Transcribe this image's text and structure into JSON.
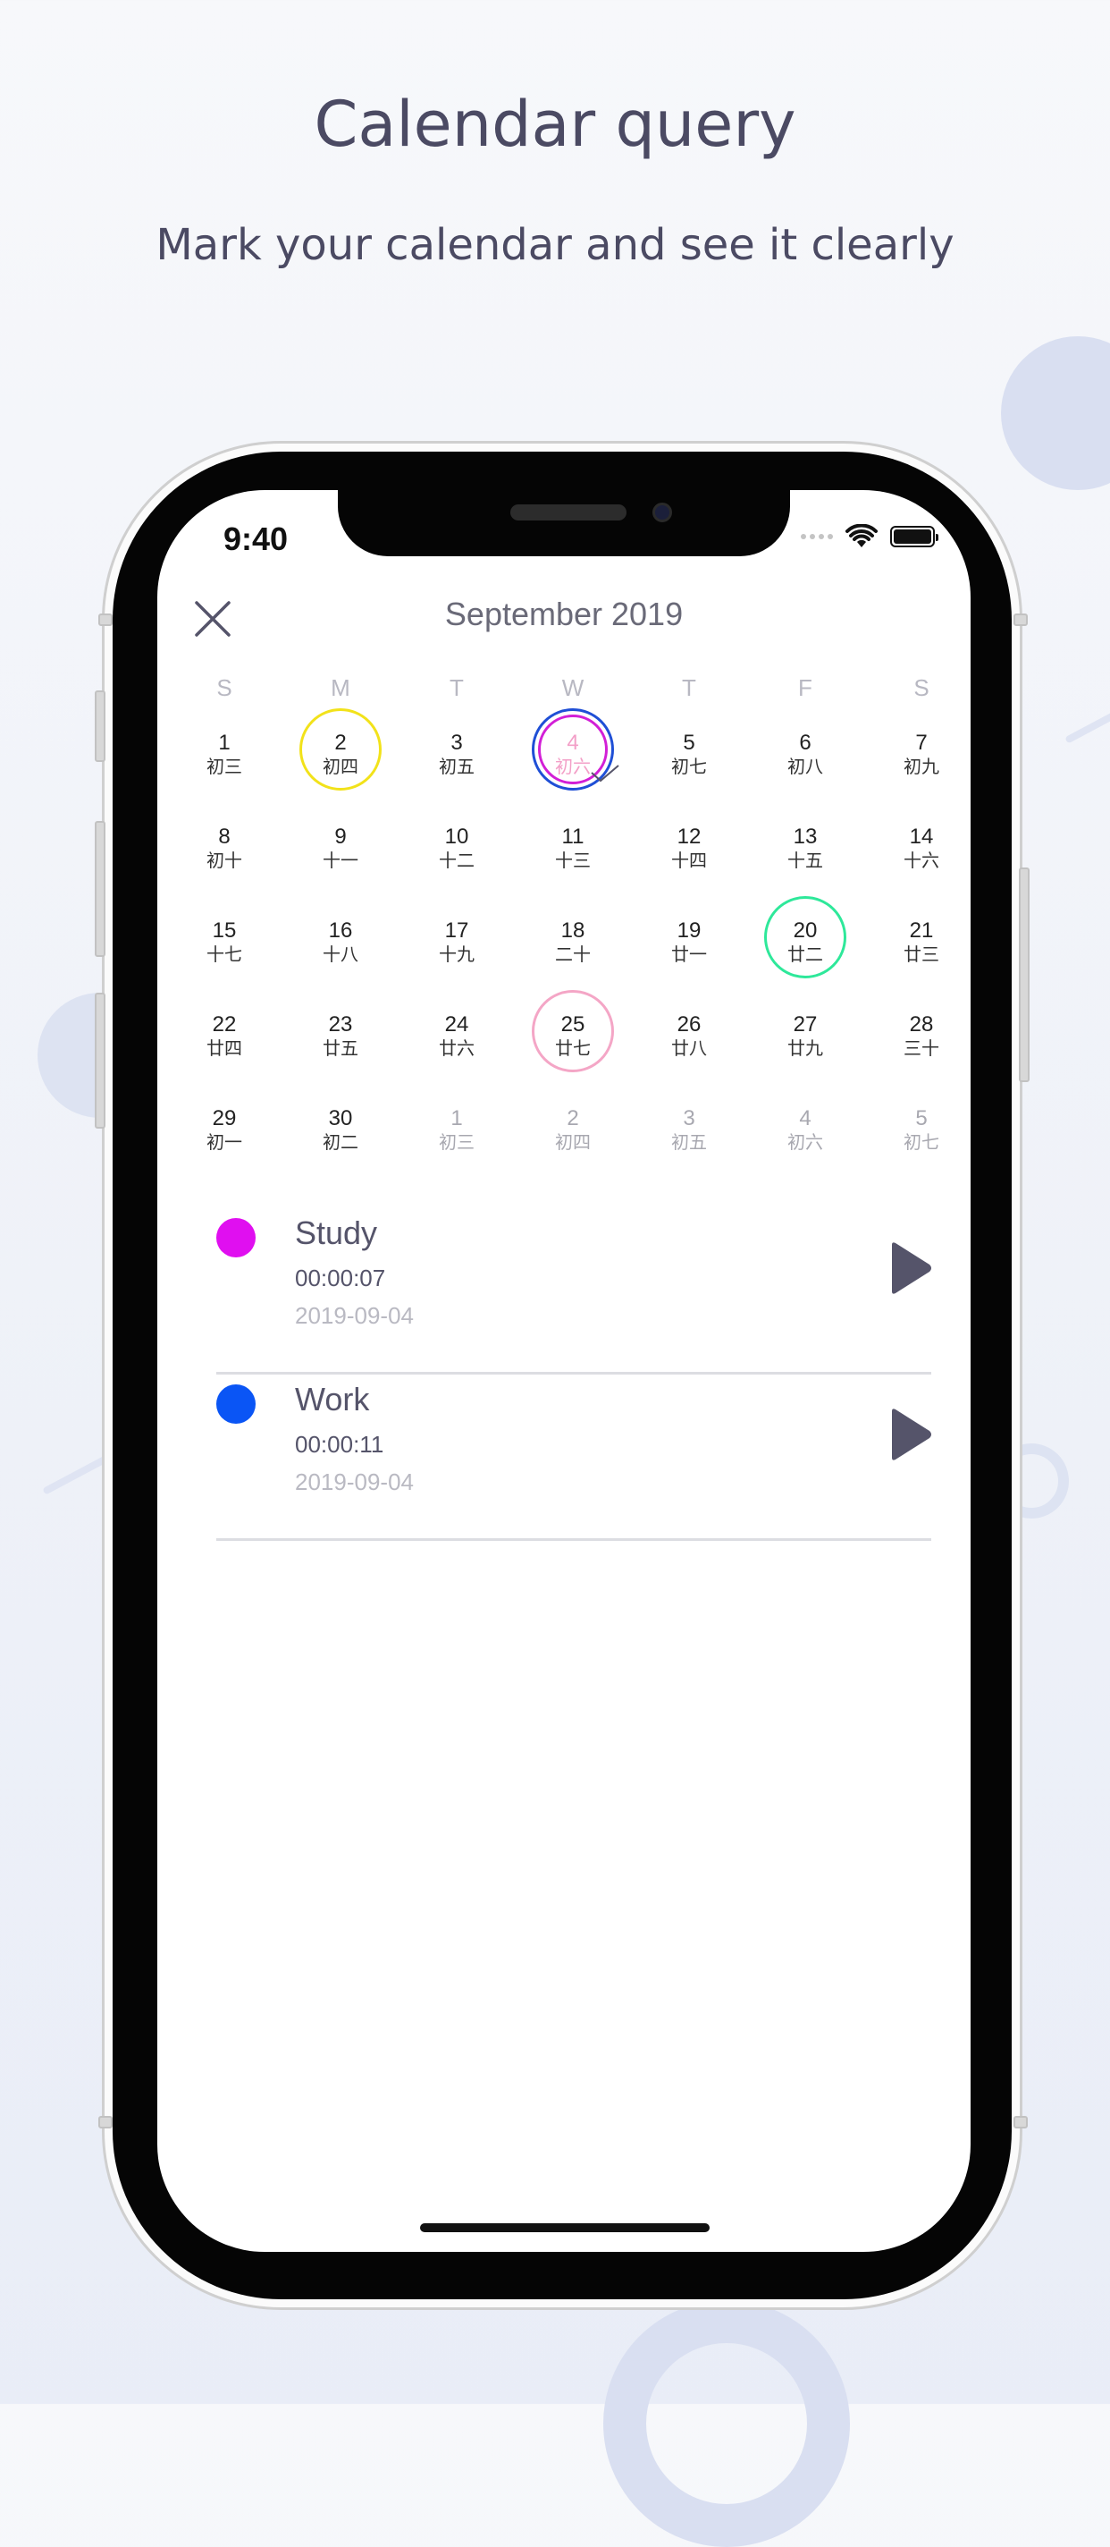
{
  "header": {
    "title": "Calendar query",
    "subtitle": "Mark your calendar and see it clearly"
  },
  "status_bar": {
    "time": "9:40"
  },
  "calendar": {
    "month_label": "September 2019",
    "weekdays": [
      "S",
      "M",
      "T",
      "W",
      "T",
      "F",
      "S"
    ],
    "weeks": [
      [
        {
          "n": "1",
          "l": "初三"
        },
        {
          "n": "2",
          "l": "初四",
          "mark": "#f2e21a"
        },
        {
          "n": "3",
          "l": "初五"
        },
        {
          "n": "4",
          "l": "初六",
          "mark": "selected"
        },
        {
          "n": "5",
          "l": "初七"
        },
        {
          "n": "6",
          "l": "初八"
        },
        {
          "n": "7",
          "l": "初九"
        }
      ],
      [
        {
          "n": "8",
          "l": "初十"
        },
        {
          "n": "9",
          "l": "十一"
        },
        {
          "n": "10",
          "l": "十二"
        },
        {
          "n": "11",
          "l": "十三"
        },
        {
          "n": "12",
          "l": "十四"
        },
        {
          "n": "13",
          "l": "十五"
        },
        {
          "n": "14",
          "l": "十六"
        }
      ],
      [
        {
          "n": "15",
          "l": "十七"
        },
        {
          "n": "16",
          "l": "十八"
        },
        {
          "n": "17",
          "l": "十九"
        },
        {
          "n": "18",
          "l": "二十"
        },
        {
          "n": "19",
          "l": "廿一"
        },
        {
          "n": "20",
          "l": "廿二",
          "mark": "#2ee89a"
        },
        {
          "n": "21",
          "l": "廿三"
        }
      ],
      [
        {
          "n": "22",
          "l": "廿四"
        },
        {
          "n": "23",
          "l": "廿五"
        },
        {
          "n": "24",
          "l": "廿六"
        },
        {
          "n": "25",
          "l": "廿七",
          "mark": "#f4a6c6"
        },
        {
          "n": "26",
          "l": "廿八"
        },
        {
          "n": "27",
          "l": "廿九"
        },
        {
          "n": "28",
          "l": "三十"
        }
      ],
      [
        {
          "n": "29",
          "l": "初一"
        },
        {
          "n": "30",
          "l": "初二"
        },
        {
          "n": "1",
          "l": "初三",
          "other": true
        },
        {
          "n": "2",
          "l": "初四",
          "other": true
        },
        {
          "n": "3",
          "l": "初五",
          "other": true
        },
        {
          "n": "4",
          "l": "初六",
          "other": true
        },
        {
          "n": "5",
          "l": "初七",
          "other": true
        }
      ]
    ]
  },
  "events": [
    {
      "name": "Study",
      "duration": "00:00:07",
      "date": "2019-09-04",
      "color": "#e00ff0"
    },
    {
      "name": "Work",
      "duration": "00:00:11",
      "date": "2019-09-04",
      "color": "#0a55f5"
    }
  ],
  "icons": {
    "close": "close-icon",
    "play": "play-icon",
    "wifi": "wifi-icon",
    "battery": "battery-icon"
  },
  "colors": {
    "selected_outer": "#1f4fd6",
    "selected_inner": "#d21fd6",
    "selected_text": "#f3a0c8"
  }
}
